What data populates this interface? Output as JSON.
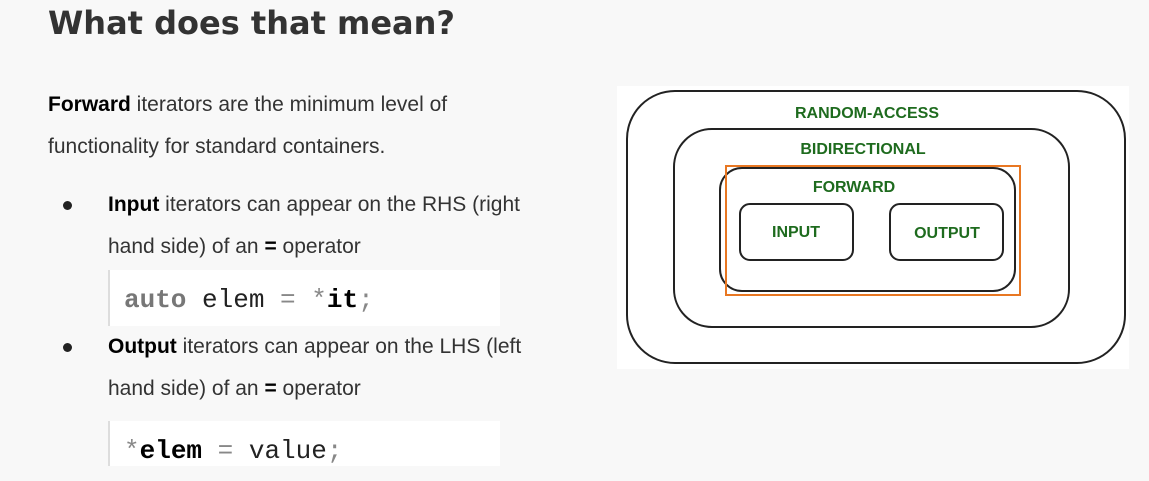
{
  "heading": "What does that mean?",
  "intro": {
    "bold": "Forward",
    "line1_rest": " iterators are the minimum level of",
    "line2": "functionality for standard containers."
  },
  "bullets": [
    {
      "bold": "Input",
      "line1_rest": " iterators can appear on the RHS (right",
      "line2_pre": "hand side) of an ",
      "op": "=",
      "line2_post": " operator",
      "code": {
        "kw": "auto",
        "var": " elem ",
        "eq": "=",
        "star": " *",
        "bold": "it",
        "semi": ";"
      }
    },
    {
      "bold": "Output",
      "line1_rest": " iterators can appear on the LHS (left",
      "line2_pre": "hand side) of an ",
      "op": "=",
      "line2_post": " operator",
      "code": {
        "star": "*",
        "bold": "elem",
        "eq": " = ",
        "val": "value",
        "semi": ";"
      }
    }
  ],
  "diagram": {
    "labels": {
      "random_access": "RANDOM-ACCESS",
      "bidirectional": "BIDIRECTIONAL",
      "forward": "FORWARD",
      "input": "INPUT",
      "output": "OUTPUT"
    },
    "colors": {
      "label_green": "#1e6b1e",
      "highlight_orange": "#e87722",
      "border": "#222222"
    }
  }
}
